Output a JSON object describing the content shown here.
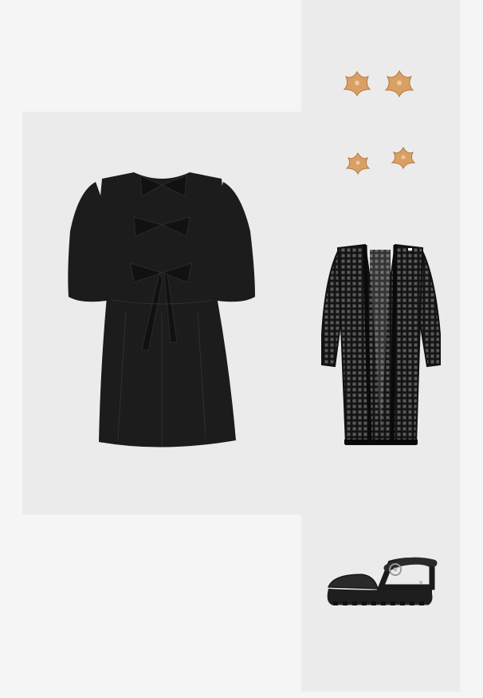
{
  "outfit": {
    "items": [
      {
        "name": "black-bow-tie-mini-dress",
        "color": "#1c1c1c"
      },
      {
        "name": "gold-flower-stud-earrings",
        "color": "#d9a066"
      },
      {
        "name": "black-open-knit-long-cardigan",
        "color": "#141414"
      },
      {
        "name": "black-chunky-strap-sandal",
        "color": "#1e1e1e"
      }
    ]
  },
  "colors": {
    "page_background": "#f5f5f5",
    "tile_background": "#ebebeb"
  }
}
